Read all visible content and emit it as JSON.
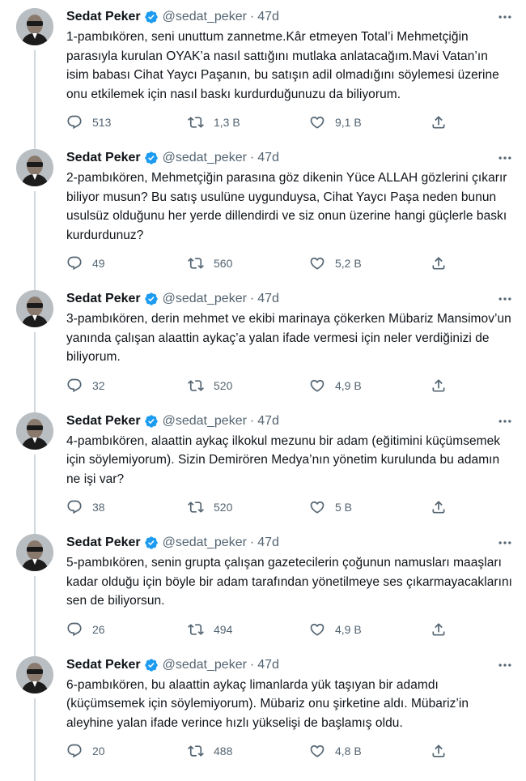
{
  "colors": {
    "text": "#0f1419",
    "muted": "#536471",
    "verified": "#1d9bf0",
    "thread_line": "#cfd9de"
  },
  "icons": [
    "verified-badge-icon",
    "more-icon",
    "reply-icon",
    "retweet-icon",
    "like-icon",
    "share-icon"
  ],
  "tweets": [
    {
      "name": "Sedat Peker",
      "handle": "@sedat_peker",
      "dot": "·",
      "time": "47d",
      "text": "1-pambıkören, seni unuttum zannetme.Kâr etmeyen Total’i Mehmetçiğin parasıyla kurulan OYAK’a nasıl sattığını mutlaka anlatacağım.Mavi Vatan’ın isim babası Cihat Yaycı Paşanın, bu satışın adil olmadığını söylemesi üzerine onu etkilemek için nasıl baskı kurdurduğunuzu da biliyorum.",
      "replies": "513",
      "retweets": "1,3 B",
      "likes": "9,1 B"
    },
    {
      "name": "Sedat Peker",
      "handle": "@sedat_peker",
      "dot": "·",
      "time": "47d",
      "text": "2-pambıkören, Mehmetçiğin parasına göz dikenin Yüce ALLAH gözlerini çıkarır biliyor musun? Bu satış usulüne uygunduysa, Cihat Yaycı Paşa neden bunun usulsüz olduğunu her yerde dillendirdi ve siz onun üzerine hangi güçlerle baskı kurdurdunuz?",
      "replies": "49",
      "retweets": "560",
      "likes": "5,2 B"
    },
    {
      "name": "Sedat Peker",
      "handle": "@sedat_peker",
      "dot": "·",
      "time": "47d",
      "text": "3-pambıkören, derin mehmet ve ekibi marinaya çökerken Mübariz Mansimov’un yanında çalışan alaattin aykaç’a yalan ifade vermesi için neler verdiğinizi de biliyorum.",
      "replies": "32",
      "retweets": "520",
      "likes": "4,9 B"
    },
    {
      "name": "Sedat Peker",
      "handle": "@sedat_peker",
      "dot": "·",
      "time": "47d",
      "text": "4-pambıkören, alaattin aykaç ilkokul mezunu bir adam (eğitimini küçümsemek için söylemiyorum). Sizin Demirören Medya’nın yönetim kurulunda bu adamın ne işi var?",
      "replies": "38",
      "retweets": "520",
      "likes": "5 B"
    },
    {
      "name": "Sedat Peker",
      "handle": "@sedat_peker",
      "dot": "·",
      "time": "47d",
      "text": "5-pambıkören, senin grupta çalışan gazetecilerin çoğunun namusları maaşları kadar olduğu için böyle bir adam tarafından yönetilmeye ses çıkarmayacaklarını sen de biliyorsun.",
      "replies": "26",
      "retweets": "494",
      "likes": "4,9 B"
    },
    {
      "name": "Sedat Peker",
      "handle": "@sedat_peker",
      "dot": "·",
      "time": "47d",
      "text": "6-pambıkören, bu alaattin aykaç limanlarda yük taşıyan bir adamdı (küçümsemek için söylemiyorum). Mübariz onu şirketine aldı. Mübariz’in aleyhine yalan ifade verince hızlı yükselişi de başlamış oldu.",
      "replies": "20",
      "retweets": "488",
      "likes": "4,8 B"
    }
  ]
}
